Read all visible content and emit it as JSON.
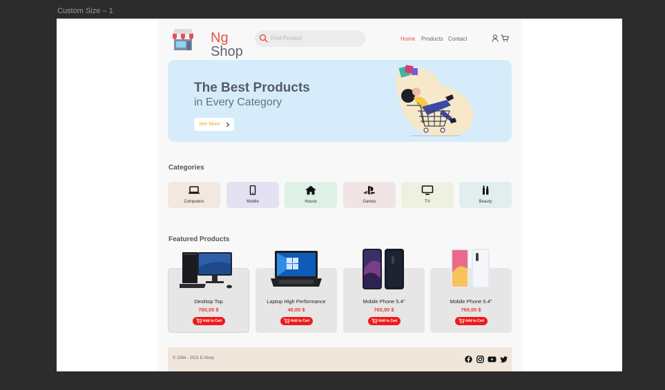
{
  "frame_label": "Custom Size – 1",
  "brand": {
    "first": "Ng",
    "second": "Shop"
  },
  "search": {
    "placeholder": "Find Product"
  },
  "nav": {
    "items": [
      "Home",
      "Products",
      "Contact"
    ],
    "active": "Home"
  },
  "hero": {
    "title": "The Best Products",
    "subtitle": "in Every Category",
    "button_label": "See More"
  },
  "categories": {
    "title": "Categories",
    "items": [
      {
        "label": "Computers",
        "icon": "laptop-icon",
        "color": "#f2e8df"
      },
      {
        "label": "Mobile",
        "icon": "mobile-icon",
        "color": "#e4e1f3"
      },
      {
        "label": "House",
        "icon": "house-icon",
        "color": "#dff0e6"
      },
      {
        "label": "Games",
        "icon": "playstation-icon",
        "color": "#f1e4e4"
      },
      {
        "label": "TV",
        "icon": "tv-icon",
        "color": "#eef0e0"
      },
      {
        "label": "Beauty",
        "icon": "beauty-icon",
        "color": "#e0efee"
      }
    ]
  },
  "featured": {
    "title": "Featured Products",
    "add_to_cart_label": "Add to Cart",
    "products": [
      {
        "name": "Desktop Top",
        "price": "760,00 $"
      },
      {
        "name": "Laptop High Performance",
        "price": "40,00 $"
      },
      {
        "name": "Mobile Phone 5.4\"",
        "price": "760,00 $"
      },
      {
        "name": "Mobile Phone 5.4\"",
        "price": "760,00 $"
      }
    ]
  },
  "footer": {
    "copyright": "© 1994 - 2021 E-Shop",
    "social": [
      "facebook-icon",
      "instagram-icon",
      "youtube-icon",
      "twitter-icon"
    ]
  },
  "colors": {
    "accent": "#e8504a",
    "price": "#e53935",
    "cart_button": "#ee1b1b",
    "hero_bg": "#d6ecfa",
    "footer_bg": "#f0e6dc"
  }
}
